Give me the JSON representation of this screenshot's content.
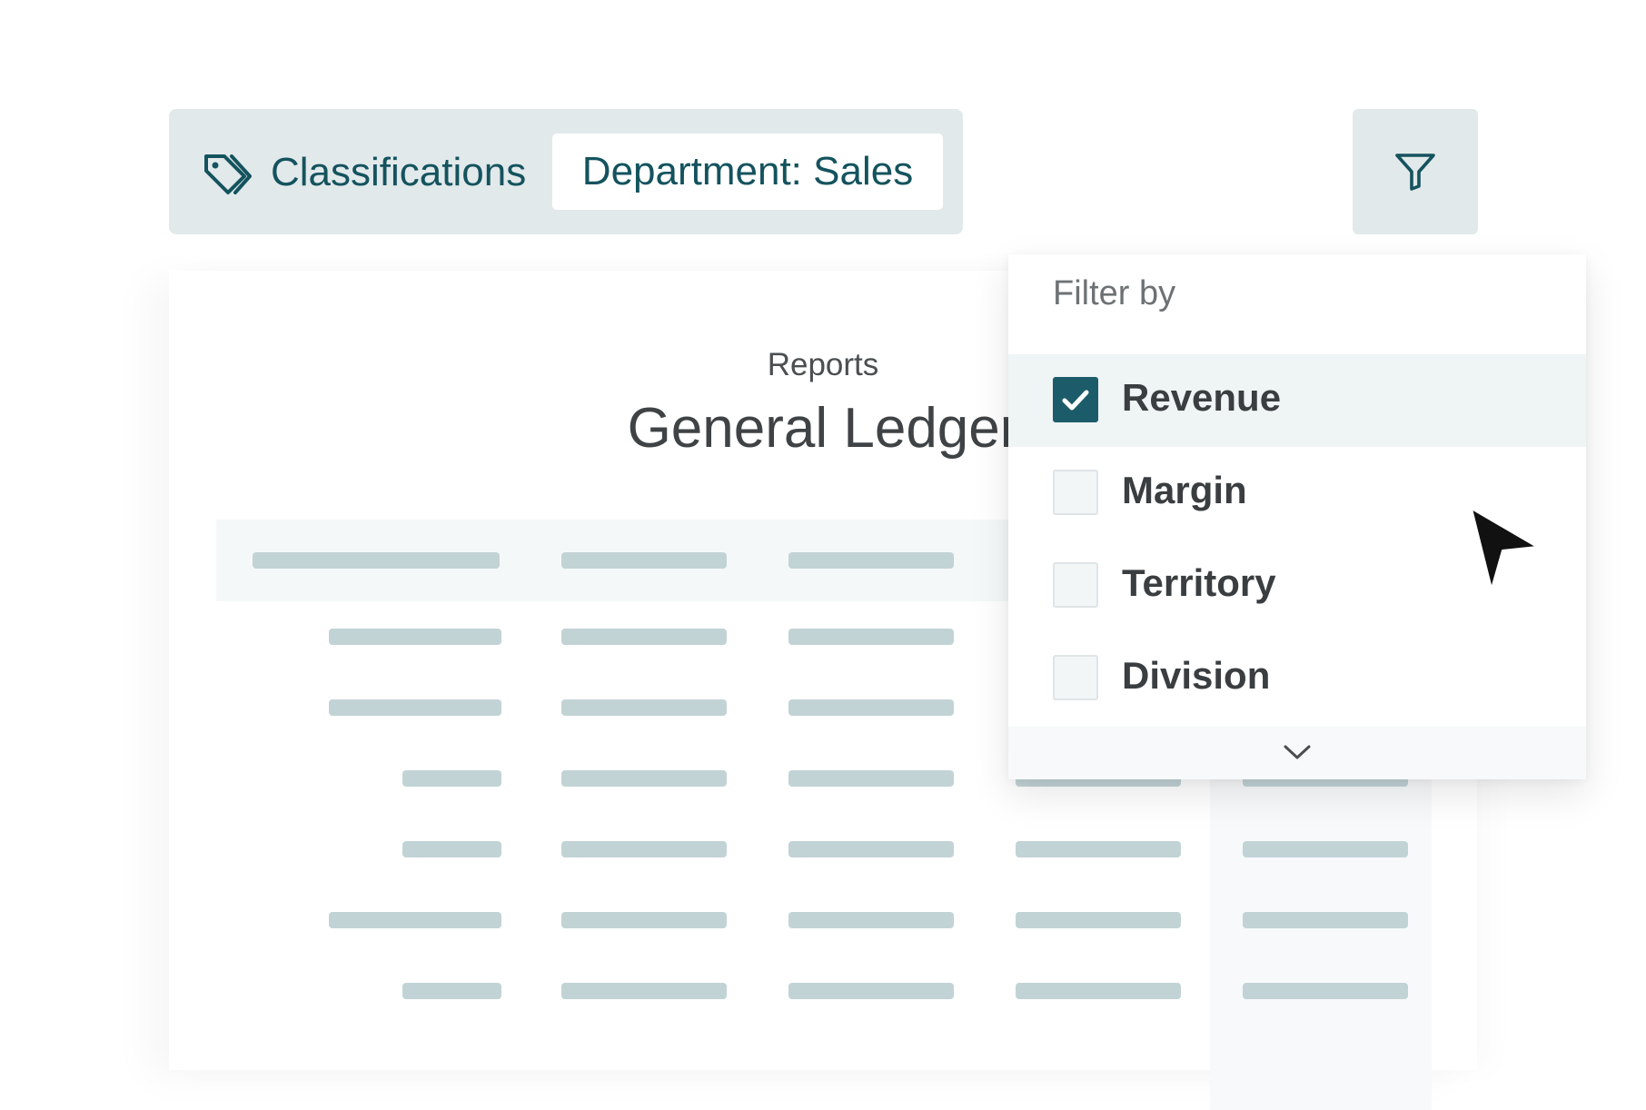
{
  "toolbar": {
    "classifications_label": "Classifications",
    "chip_label": "Department: Sales"
  },
  "report": {
    "subtitle": "Reports",
    "title": "General Ledger"
  },
  "filter": {
    "title": "Filter by",
    "items": [
      {
        "label": "Revenue",
        "checked": true
      },
      {
        "label": "Margin",
        "checked": false
      },
      {
        "label": "Territory",
        "checked": false
      },
      {
        "label": "Division",
        "checked": false
      }
    ]
  },
  "colors": {
    "accent": "#14535e",
    "checkbox_checked": "#1c5c6a",
    "bar_background": "#e2e9eb",
    "placeholder_bar": "#c2d3d6"
  },
  "icons": {
    "tag": "tag-icon",
    "filter": "filter-icon",
    "checkmark": "checkmark-icon",
    "chevron": "chevron-down-icon",
    "cursor": "mouse-pointer-icon"
  }
}
